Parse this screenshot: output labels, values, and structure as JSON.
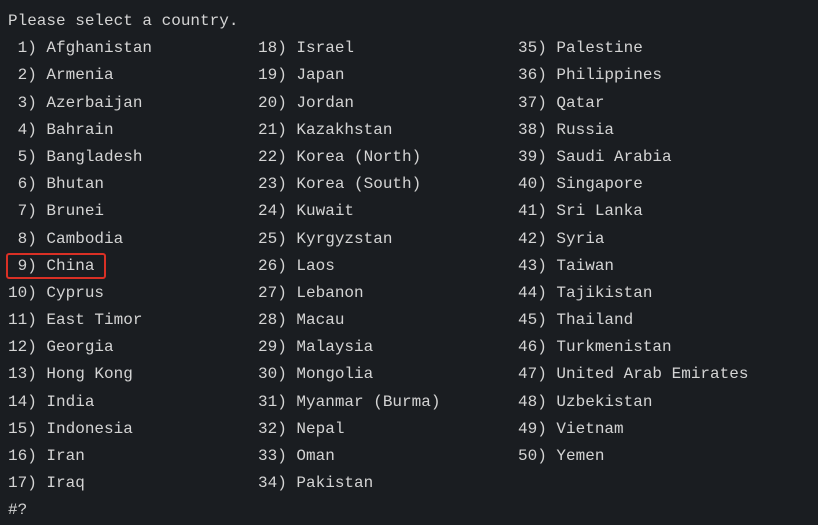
{
  "header": "Please select a country.",
  "input_prompt": "#?",
  "highlight_index": 9,
  "countries": {
    "col1": [
      {
        "n": "1",
        "name": "Afghanistan"
      },
      {
        "n": "2",
        "name": "Armenia"
      },
      {
        "n": "3",
        "name": "Azerbaijan"
      },
      {
        "n": "4",
        "name": "Bahrain"
      },
      {
        "n": "5",
        "name": "Bangladesh"
      },
      {
        "n": "6",
        "name": "Bhutan"
      },
      {
        "n": "7",
        "name": "Brunei"
      },
      {
        "n": "8",
        "name": "Cambodia"
      },
      {
        "n": "9",
        "name": "China"
      },
      {
        "n": "10",
        "name": "Cyprus"
      },
      {
        "n": "11",
        "name": "East Timor"
      },
      {
        "n": "12",
        "name": "Georgia"
      },
      {
        "n": "13",
        "name": "Hong Kong"
      },
      {
        "n": "14",
        "name": "India"
      },
      {
        "n": "15",
        "name": "Indonesia"
      },
      {
        "n": "16",
        "name": "Iran"
      },
      {
        "n": "17",
        "name": "Iraq"
      }
    ],
    "col2": [
      {
        "n": "18",
        "name": "Israel"
      },
      {
        "n": "19",
        "name": "Japan"
      },
      {
        "n": "20",
        "name": "Jordan"
      },
      {
        "n": "21",
        "name": "Kazakhstan"
      },
      {
        "n": "22",
        "name": "Korea (North)"
      },
      {
        "n": "23",
        "name": "Korea (South)"
      },
      {
        "n": "24",
        "name": "Kuwait"
      },
      {
        "n": "25",
        "name": "Kyrgyzstan"
      },
      {
        "n": "26",
        "name": "Laos"
      },
      {
        "n": "27",
        "name": "Lebanon"
      },
      {
        "n": "28",
        "name": "Macau"
      },
      {
        "n": "29",
        "name": "Malaysia"
      },
      {
        "n": "30",
        "name": "Mongolia"
      },
      {
        "n": "31",
        "name": "Myanmar (Burma)"
      },
      {
        "n": "32",
        "name": "Nepal"
      },
      {
        "n": "33",
        "name": "Oman"
      },
      {
        "n": "34",
        "name": "Pakistan"
      }
    ],
    "col3": [
      {
        "n": "35",
        "name": "Palestine"
      },
      {
        "n": "36",
        "name": "Philippines"
      },
      {
        "n": "37",
        "name": "Qatar"
      },
      {
        "n": "38",
        "name": "Russia"
      },
      {
        "n": "39",
        "name": "Saudi Arabia"
      },
      {
        "n": "40",
        "name": "Singapore"
      },
      {
        "n": "41",
        "name": "Sri Lanka"
      },
      {
        "n": "42",
        "name": "Syria"
      },
      {
        "n": "43",
        "name": "Taiwan"
      },
      {
        "n": "44",
        "name": "Tajikistan"
      },
      {
        "n": "45",
        "name": "Thailand"
      },
      {
        "n": "46",
        "name": "Turkmenistan"
      },
      {
        "n": "47",
        "name": "United Arab Emirates"
      },
      {
        "n": "48",
        "name": "Uzbekistan"
      },
      {
        "n": "49",
        "name": "Vietnam"
      },
      {
        "n": "50",
        "name": "Yemen"
      }
    ]
  }
}
